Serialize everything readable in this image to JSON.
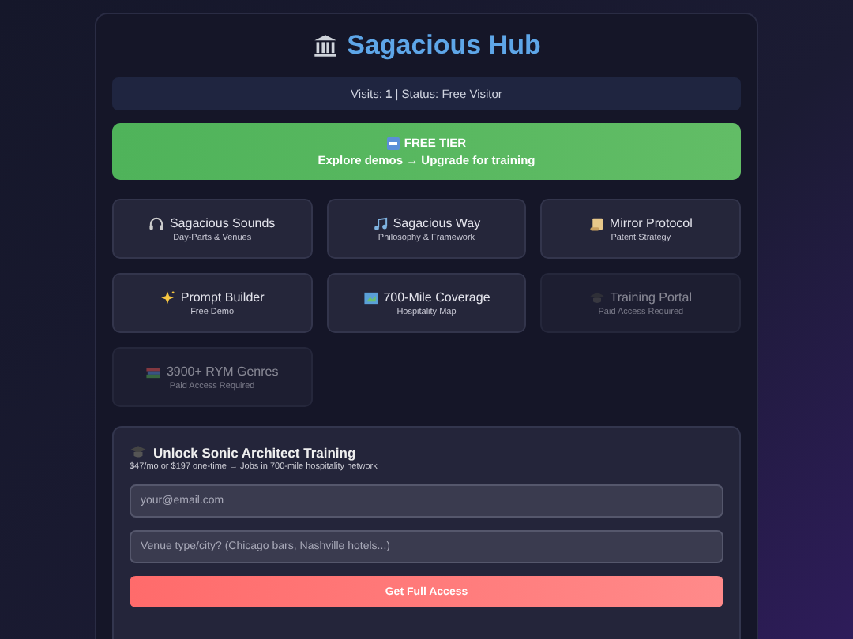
{
  "title": "Sagacious Hub",
  "status_bar": "Visits: **1** | Status: Free Visitor",
  "tier_banner": {
    "title": "FREE TIER",
    "subtitle": "Explore demos → Upgrade for training"
  },
  "tiles": [
    {
      "title": "Sagacious Sounds",
      "subtitle": "Day-Parts & Venues",
      "locked": false
    },
    {
      "title": "Sagacious Way",
      "subtitle": "Philosophy & Framework",
      "locked": false
    },
    {
      "title": "Mirror Protocol",
      "subtitle": "Patent Strategy",
      "locked": false
    },
    {
      "title": "Prompt Builder",
      "subtitle": "Free Demo",
      "locked": false
    },
    {
      "title": "700-Mile Coverage",
      "subtitle": "Hospitality Map",
      "locked": false
    },
    {
      "title": "Training Portal",
      "subtitle": "Paid Access Required",
      "locked": true
    },
    {
      "title": "3900+ RYM Genres",
      "subtitle": "Paid Access Required",
      "locked": true
    }
  ],
  "signup": {
    "title": "Unlock Sonic Architect Training",
    "subtitle": "$47/mo or $197 one-time → Jobs in 700-mile hospitality network",
    "email_field": {
      "placeholder": "your@email.com"
    },
    "venue_field": {
      "placeholder": "Venue type/city? (Chicago bars, Nashville hotels...)"
    },
    "button": "Get Full Access"
  }
}
